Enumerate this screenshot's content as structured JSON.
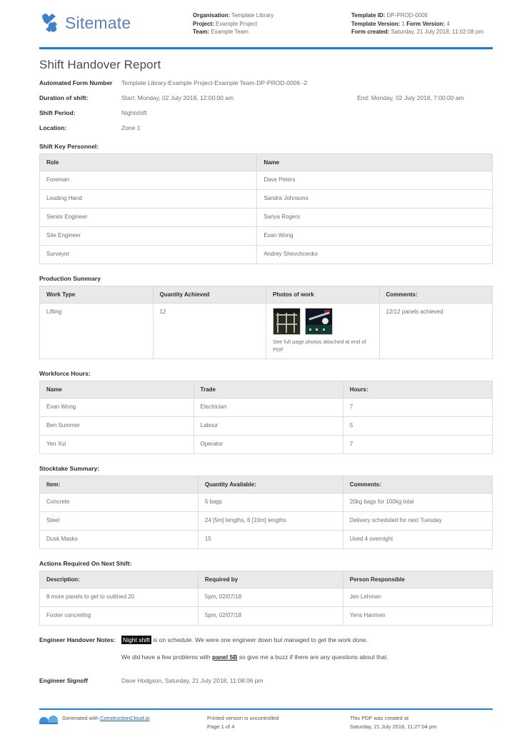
{
  "header": {
    "logo_text": "Sitemate",
    "logo_icon": "sitemate-logo-icon",
    "left_meta": [
      {
        "label": "Organisation:",
        "value": "Template Library"
      },
      {
        "label": "Project:",
        "value": "Example Project"
      },
      {
        "label": "Team:",
        "value": "Example Team"
      }
    ],
    "right_meta": [
      {
        "label": "Template ID:",
        "value": "DP-PROD-0006"
      },
      {
        "label": "Template Version:",
        "value": "1",
        "label2": "Form Version:",
        "value2": "4"
      },
      {
        "label": "Form created:",
        "value": "Saturday, 21 July 2018, 11:02:08 pm"
      }
    ],
    "accent_color": "#1a7fd4"
  },
  "title": "Shift Handover Report",
  "fields": [
    {
      "label": "Automated Form Number",
      "value": "Template Library-Example Project-Example Team-DP-PROD-0006   -2"
    },
    {
      "label": "Duration of shift:",
      "start": "Start: Monday, 02 July 2018, 12:00:00 am",
      "end": "End: Monday, 02 July 2018, 7:00:00 am"
    },
    {
      "label": "Shift Period:",
      "value": "Nightshift"
    },
    {
      "label": "Location:",
      "value": "Zone 1"
    }
  ],
  "personnel": {
    "heading": "Shift Key Personnel:",
    "columns": [
      "Role",
      "Name"
    ],
    "rows": [
      [
        "Foreman",
        "Dave Peters"
      ],
      [
        "Leading Hand",
        "Sandra Johnsons"
      ],
      [
        "Senior Engineer",
        "Sanya Rogers"
      ],
      [
        "Site Engineer",
        "Evan Wong"
      ],
      [
        "Surveyor",
        "Andrey Shevchcenko"
      ]
    ]
  },
  "production": {
    "heading": "Production Summary",
    "columns": [
      "Work Type",
      "Quantity Achieved",
      "Photos of work",
      "Comments:"
    ],
    "work_type": "Lifting",
    "quantity": "12",
    "photo_note": "See full page photos attached at end of PDF",
    "photo_icons": [
      "scaffold-photo-thumbnail",
      "night-site-photo-thumbnail"
    ],
    "comments": "12/12 panels achieved"
  },
  "workforce": {
    "heading": "Workforce Hours:",
    "columns": [
      "Name",
      "Trade",
      "Hours:"
    ],
    "rows": [
      [
        "Evan Wong",
        "Electrician",
        "7"
      ],
      [
        "Ben Summer",
        "Labour",
        "5"
      ],
      [
        "Yen Xui",
        "Operator",
        "7"
      ]
    ]
  },
  "stocktake": {
    "heading": "Stocktake Summary:",
    "columns": [
      "Item:",
      "Quantity Available:",
      "Comments:"
    ],
    "rows": [
      [
        "Concrete",
        "5 bags",
        "20kg bags for 100kg total"
      ],
      [
        "Steel",
        "24 [5m] lengths, 6 [10m] lengths",
        "Delivery scheduled for next Tuesday"
      ],
      [
        "Dusk Masks",
        "15",
        "Used 4 overnight"
      ]
    ]
  },
  "actions": {
    "heading": "Actions Required On Next Shift:",
    "columns": [
      "Description:",
      "Required by",
      "Person Responsible"
    ],
    "rows": [
      [
        "8 more panels to get to outlined 20",
        "5pm, 02/07/18",
        "Jen Lehman"
      ],
      [
        "Footer concreting",
        "5pm, 02/07/18",
        "Yens Hanmen"
      ]
    ]
  },
  "notes": {
    "label": "Engineer Handover Notes:",
    "line1_highlight": "Night shift",
    "line1_rest": " is on schedule. We were one engineer down but managed to get the work done.",
    "line2_before": "We did have a few problems with ",
    "line2_emphasis": "panel 5B",
    "line2_after": " so give me a buzz if there are any questions about that.",
    "highlight_color": "#111111"
  },
  "signoff": {
    "label": "Engineer Signoff",
    "value": "Dave Hodgson, Saturday, 21 July 2018, 11:08:06 pm"
  },
  "footer": {
    "hat_icon": "hard-hat-icon",
    "generated_prefix": "Generated with ",
    "generated_link": "ConstructionCloud.io",
    "printed_note": "Printed version is uncontrolled",
    "page_number": "Page 1 of 4",
    "created_label": "This PDF was created at",
    "created_value": "Saturday, 21 July 2018, 11:27:04 pm",
    "link_color": "#2a5db0"
  }
}
